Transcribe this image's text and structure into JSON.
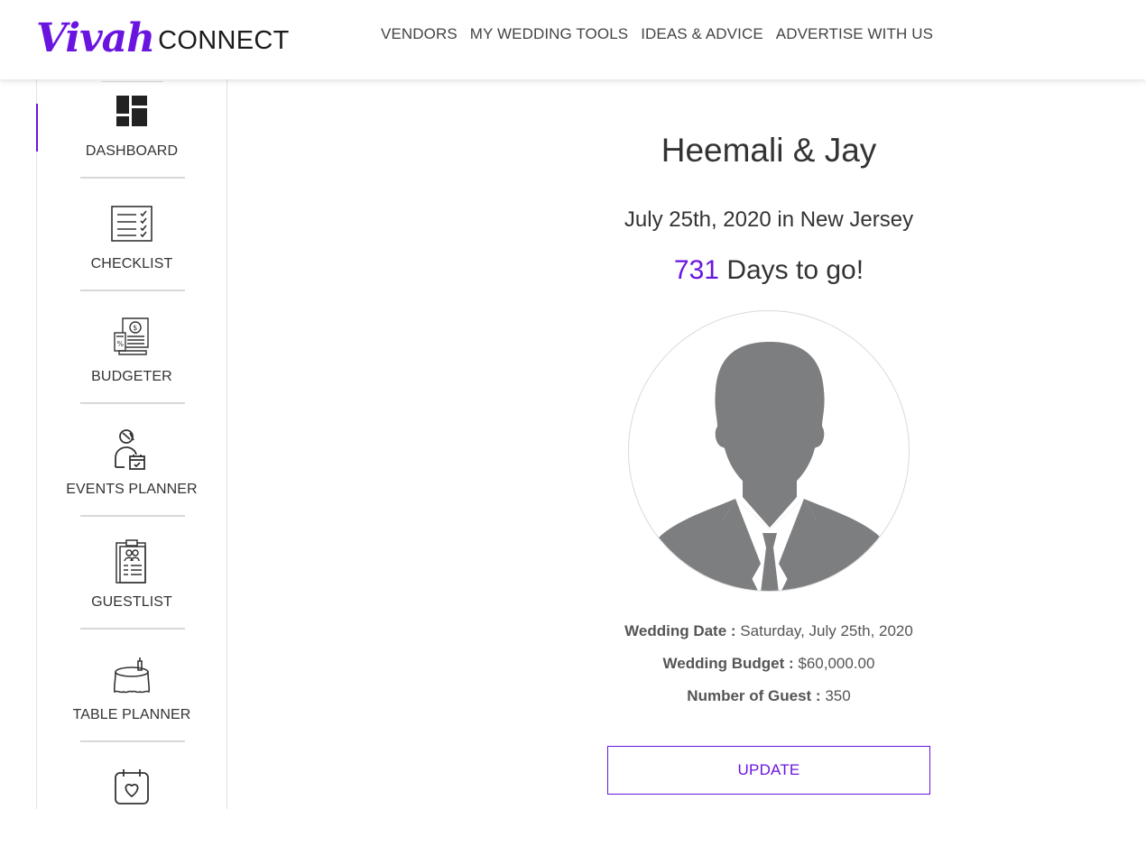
{
  "brand": {
    "script": "Vivah",
    "word": "CONNECT",
    "accent": "#6a14e0"
  },
  "nav": [
    {
      "label": "VENDORS"
    },
    {
      "label": "MY WEDDING TOOLS"
    },
    {
      "label": "IDEAS & ADVICE"
    },
    {
      "label": "ADVERTISE WITH US"
    }
  ],
  "sidebar": {
    "items": [
      {
        "label": "DASHBOARD",
        "icon": "dashboard-icon",
        "active": true
      },
      {
        "label": "CHECKLIST",
        "icon": "checklist-icon"
      },
      {
        "label": "BUDGETER",
        "icon": "budget-icon"
      },
      {
        "label": "EVENTS PLANNER",
        "icon": "events-planner-icon"
      },
      {
        "label": "GUESTLIST",
        "icon": "guestlist-icon"
      },
      {
        "label": "TABLE PLANNER",
        "icon": "table-planner-icon"
      },
      {
        "label": "",
        "icon": "calendar-heart-icon"
      }
    ]
  },
  "profile": {
    "couple": "Heemali & Jay",
    "date_place": "July 25th, 2020 in New Jersey",
    "days_count": "731",
    "days_suffix": "Days to go!",
    "avatar_icon": "person-silhouette-icon",
    "details": [
      {
        "label": "Wedding Date :",
        "value": "Saturday, July 25th, 2020"
      },
      {
        "label": "Wedding Budget :",
        "value": "$60,000.00"
      },
      {
        "label": "Number of Guest :",
        "value": "350"
      }
    ],
    "update_label": "UPDATE"
  }
}
